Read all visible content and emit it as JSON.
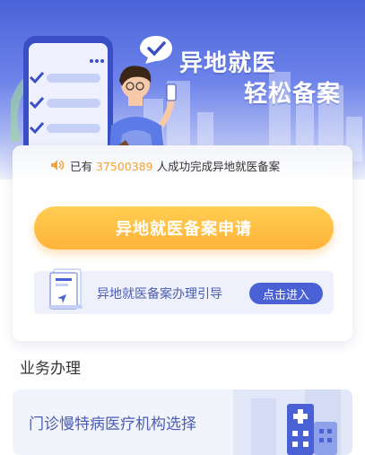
{
  "hero": {
    "title_line1": "异地就医",
    "title_line2": "轻松备案"
  },
  "notice": {
    "prefix": "已有 ",
    "count": "37500389",
    "suffix": " 人成功完成异地就医备案",
    "icon": "speaker-icon"
  },
  "main": {
    "apply_label": "异地就医备案申请",
    "guide_label": "异地就医备案办理引导",
    "guide_button": "点击进入"
  },
  "section": {
    "title": "业务办理",
    "items": [
      {
        "label": "门诊慢特病医疗机构选择",
        "icon": "hospital-icon"
      }
    ]
  },
  "colors": {
    "brand_blue": "#4a61d6",
    "accent_orange": "#ffb33a",
    "count_orange": "#f2a43a"
  }
}
